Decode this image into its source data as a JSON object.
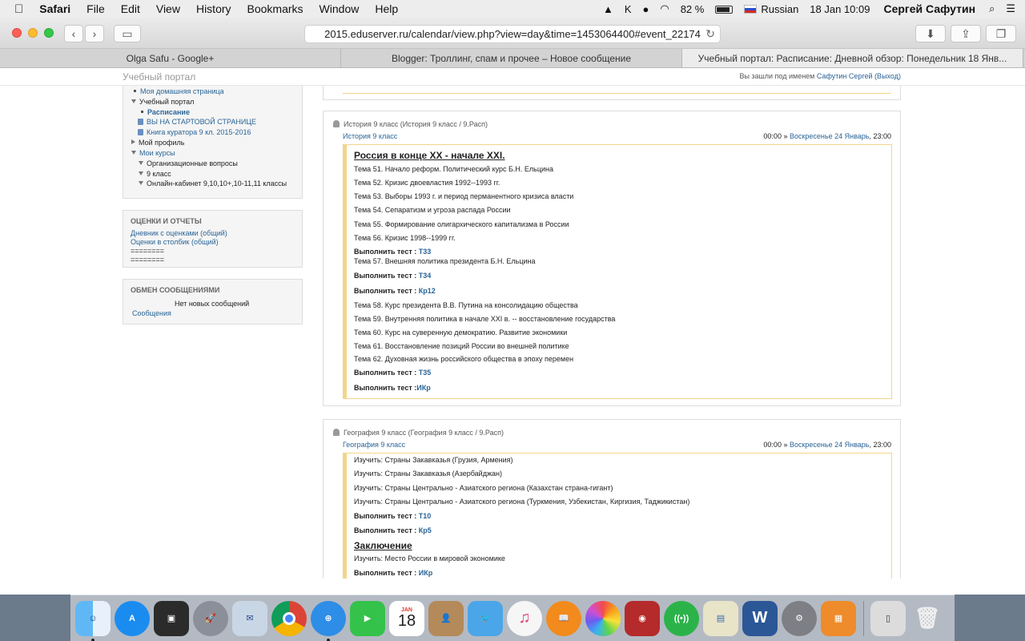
{
  "menubar": {
    "apple": "",
    "app": "Safari",
    "items": [
      "File",
      "Edit",
      "View",
      "History",
      "Bookmarks",
      "Window",
      "Help"
    ],
    "battery": "82 %",
    "language": "Russian",
    "datetime": "18 Jan  10:09",
    "user": "Сергей Сафутин"
  },
  "browser": {
    "url": "2015.eduserver.ru/calendar/view.php?view=day&time=1453064400#event_22174",
    "tabs": [
      "Olga Safu - Google+",
      "Blogger: Троллинг, спам и прочее – Новое сообщение",
      "Учебный портал: Расписание: Дневной обзор: Понедельник 18 Янв..."
    ]
  },
  "page": {
    "site_name": "Учебный портал",
    "login_text": "Вы зашли под именем",
    "login_user": "Сафутин Сергей",
    "logout": "(Выход)"
  },
  "sidebar": {
    "nav": [
      "Моя домашняя страница",
      "Учебный портал",
      "Расписание",
      "ВЫ НА СТАРТОВОЙ СТРАНИЦЕ",
      "Книга куратора 9 кл. 2015-2016",
      "Мой профиль",
      "Мои курсы",
      "Организационные вопросы",
      "9 класс",
      "Онлайн-кабинет 9,10,10+,10-11,11 классы"
    ],
    "grades": {
      "title": "ОЦЕНКИ И ОТЧЕТЫ",
      "links": [
        "Дневник с оценками (общий)",
        "Оценки в столбик (общий)"
      ],
      "sep": "========"
    },
    "messages": {
      "title": "ОБМЕН СООБЩЕНИЯМИ",
      "none": "Нет новых сообщений",
      "link": "Сообщения"
    }
  },
  "events": [
    {
      "title": "История 9 класс (История 9 класс / 9.Расп)",
      "course": "История 9 класс",
      "time_start": "00:00 »",
      "time_day": "Воскресенье 24 Январь",
      "time_end": ", 23:00",
      "heading": "Россия в конце XX - начале XXI.",
      "lines": [
        {
          "text": "Тема 51. Начало реформ. Политический курс Б.Н. Ельцина"
        },
        {
          "text": "Тема 52. Кризис двоевластия 1992--1993 гг."
        },
        {
          "text": "Тема 53. Выборы 1993 г. и период перманентного кризиса власти"
        },
        {
          "text": "Тема 54. Сепаратизм и угроза распада России"
        },
        {
          "text": "Тема 55. Формирование олигархического капитализма в России"
        },
        {
          "text": "Тема 56. Кризис 1998--1999 гг."
        },
        {
          "label": "Выполнить тест :",
          "link": "Т33"
        },
        {
          "text": "Тема 57. Внешняя политика президента Б.Н. Ельцина"
        },
        {
          "label": "Выполнить тест :",
          "link": "Т34"
        },
        {
          "label": "Выполнить тест :",
          "link": "Кр12"
        },
        {
          "text": "Тема 58. Курс президента В.В. Путина на консолидацию общества"
        },
        {
          "text": "Тема 59. Внутренняя политика в начале XXI в. -- восстановление государства"
        },
        {
          "text": "Тема 60. Курс на суверенную демократию. Развитие экономики"
        },
        {
          "text": "Тема 61. Восстановление позиций России во внешней политике"
        },
        {
          "text": "Тема 62. Духовная жизнь российского общества в эпоху перемен"
        },
        {
          "label": "Выполнить тест :",
          "link": "Т35"
        },
        {
          "label": "Выполнить тест :",
          "link": "ИКр"
        }
      ]
    },
    {
      "title": "География 9 класс (География 9 класс / 9.Расп)",
      "course": "География 9 класс",
      "time_start": "00:00 »",
      "time_day": "Воскресенье 24 Январь",
      "time_end": ", 23:00",
      "lines": [
        {
          "text": "Изучить: Страны Закавказья (Грузия, Армения)"
        },
        {
          "text": "Изучить: Страны Закавказья (Азербайджан)"
        },
        {
          "text": "Изучить: Страны  Центрально - Азиатского региона (Казахстан страна-гигант)"
        },
        {
          "text": "Изучить: Страны  Центрально - Азиатского региона (Туркмения, Узбекистан, Киргизия, Таджикистан)"
        },
        {
          "label": "Выполнить тест :",
          "link": "Т10"
        },
        {
          "label": "Выполнить тест :",
          "link": "Кр5"
        },
        {
          "heading": "Заключение "
        },
        {
          "text": "Изучить: Место России в мировой экономике"
        },
        {
          "label": "Выполнить тест :",
          "link": "ИКр"
        }
      ]
    }
  ],
  "dock": {
    "calendar_month": "JAN",
    "calendar_day": "18",
    "apps": [
      "Finder",
      "App Store",
      "Preview",
      "Launchpad",
      "Mail",
      "Chrome",
      "Safari",
      "FaceTime",
      "Calendar",
      "Contacts",
      "Twitter",
      "iTunes",
      "iBooks",
      "Photos",
      "Photo Booth",
      "Wireless",
      "Keynote",
      "Word",
      "System Preferences",
      "Calculator",
      "Phone",
      "Trash"
    ]
  }
}
